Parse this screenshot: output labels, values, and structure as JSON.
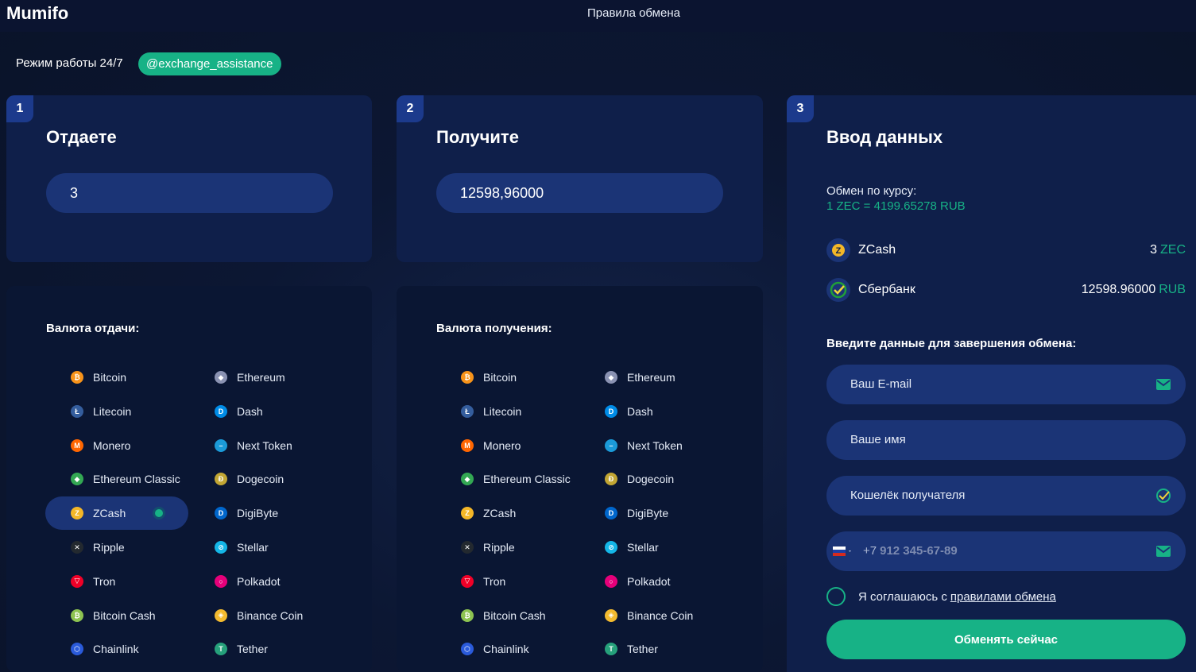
{
  "header": {
    "logo": "Mumifo",
    "rules_link": "Правила обмена"
  },
  "support": {
    "work_mode": "Режим работы 24/7",
    "telegram": "@exchange_assistance"
  },
  "give": {
    "step": "1",
    "title": "Отдаете",
    "amount": "3",
    "list_title": "Валюта отдачи:",
    "selected": "ZCash"
  },
  "receive": {
    "step": "2",
    "title": "Получите",
    "amount": "12598,96000",
    "list_title": "Валюта получения:"
  },
  "currencies": [
    {
      "name": "Bitcoin",
      "icon": "bitcoin-icon",
      "color": "#f7931a",
      "glyph": "₿"
    },
    {
      "name": "Ethereum",
      "icon": "ethereum-icon",
      "color": "#8a92b2",
      "glyph": "◆"
    },
    {
      "name": "Litecoin",
      "icon": "litecoin-icon",
      "color": "#345d9d",
      "glyph": "Ł"
    },
    {
      "name": "Dash",
      "icon": "dash-icon",
      "color": "#008ce7",
      "glyph": "D"
    },
    {
      "name": "Monero",
      "icon": "monero-icon",
      "color": "#ff6600",
      "glyph": "M"
    },
    {
      "name": "Next Token",
      "icon": "next-token-icon",
      "color": "#1b9ad8",
      "glyph": "–"
    },
    {
      "name": "Ethereum Classic",
      "icon": "ethereum-classic-icon",
      "color": "#33a853",
      "glyph": "◆"
    },
    {
      "name": "Dogecoin",
      "icon": "dogecoin-icon",
      "color": "#c2a633",
      "glyph": "Ð"
    },
    {
      "name": "ZCash",
      "icon": "zcash-icon",
      "color": "#f4b728",
      "glyph": "Z"
    },
    {
      "name": "DigiByte",
      "icon": "digibyte-icon",
      "color": "#0066cc",
      "glyph": "D"
    },
    {
      "name": "Ripple",
      "icon": "ripple-icon",
      "color": "#23292f",
      "glyph": "✕"
    },
    {
      "name": "Stellar",
      "icon": "stellar-icon",
      "color": "#14b6e7",
      "glyph": "⊘"
    },
    {
      "name": "Tron",
      "icon": "tron-icon",
      "color": "#ef0027",
      "glyph": "▽"
    },
    {
      "name": "Polkadot",
      "icon": "polkadot-icon",
      "color": "#e6007a",
      "glyph": "○"
    },
    {
      "name": "Bitcoin Cash",
      "icon": "bitcoin-cash-icon",
      "color": "#8dc351",
      "glyph": "₿"
    },
    {
      "name": "Binance Coin",
      "icon": "binance-coin-icon",
      "color": "#f3ba2f",
      "glyph": "◈"
    },
    {
      "name": "Chainlink",
      "icon": "chainlink-icon",
      "color": "#2a5ada",
      "glyph": "⬡"
    },
    {
      "name": "Tether",
      "icon": "tether-icon",
      "color": "#26a17b",
      "glyph": "T"
    }
  ],
  "data_entry": {
    "step": "3",
    "title": "Ввод данных",
    "rate_label": "Обмен по курсу:",
    "rate_value": "1 ZEC = 4199.65278 RUB",
    "from_name": "ZCash",
    "from_amount": "3",
    "from_code": "ZEC",
    "to_name": "Сбербанк",
    "to_amount": "12598.96000",
    "to_code": "RUB",
    "form_title": "Введите данные для завершения обмена:",
    "email_placeholder": "Ваш E-mail",
    "name_placeholder": "Ваше имя",
    "wallet_placeholder": "Кошелёк получателя",
    "phone_prefix": "+7",
    "phone_placeholder": "912 345-67-89",
    "agree_text": "Я соглашаюсь с",
    "agree_link": "правилами обмена",
    "submit": "Обменять сейчас"
  },
  "colors": {
    "accent": "#17b286",
    "card": "#0f1f4a",
    "input": "#1b3476"
  }
}
